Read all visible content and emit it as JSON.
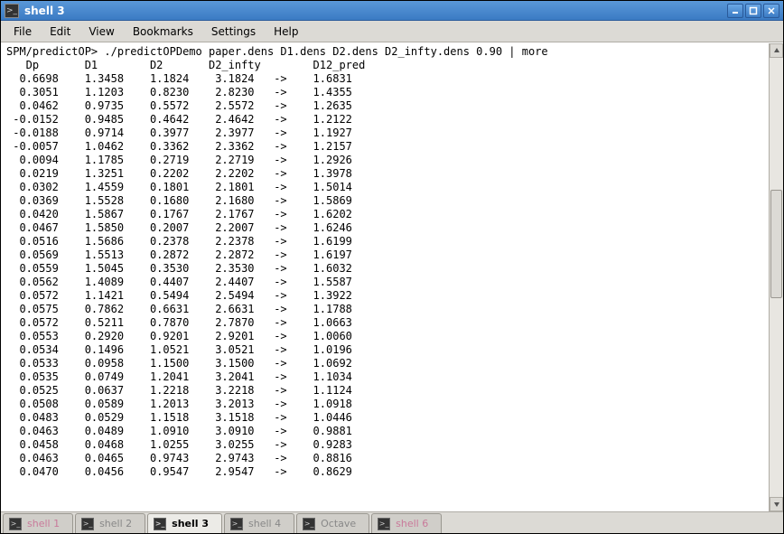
{
  "titlebar": {
    "title": "shell 3"
  },
  "menu": {
    "file": "File",
    "edit": "Edit",
    "view": "View",
    "bookmarks": "Bookmarks",
    "settings": "Settings",
    "help": "Help"
  },
  "prompt": "SPM/predictOP>",
  "command": "./predictOPDemo paper.dens D1.dens D2.dens D2_infty.dens 0.90 | more",
  "columns": [
    "Dp",
    "D1",
    "D2",
    "D2_infty",
    "D12_pred"
  ],
  "rows": [
    [
      "0.6698",
      "1.3458",
      "1.1824",
      "3.1824",
      "1.6831"
    ],
    [
      "0.3051",
      "1.1203",
      "0.8230",
      "2.8230",
      "1.4355"
    ],
    [
      "0.0462",
      "0.9735",
      "0.5572",
      "2.5572",
      "1.2635"
    ],
    [
      "-0.0152",
      "0.9485",
      "0.4642",
      "2.4642",
      "1.2122"
    ],
    [
      "-0.0188",
      "0.9714",
      "0.3977",
      "2.3977",
      "1.1927"
    ],
    [
      "-0.0057",
      "1.0462",
      "0.3362",
      "2.3362",
      "1.2157"
    ],
    [
      "0.0094",
      "1.1785",
      "0.2719",
      "2.2719",
      "1.2926"
    ],
    [
      "0.0219",
      "1.3251",
      "0.2202",
      "2.2202",
      "1.3978"
    ],
    [
      "0.0302",
      "1.4559",
      "0.1801",
      "2.1801",
      "1.5014"
    ],
    [
      "0.0369",
      "1.5528",
      "0.1680",
      "2.1680",
      "1.5869"
    ],
    [
      "0.0420",
      "1.5867",
      "0.1767",
      "2.1767",
      "1.6202"
    ],
    [
      "0.0467",
      "1.5850",
      "0.2007",
      "2.2007",
      "1.6246"
    ],
    [
      "0.0516",
      "1.5686",
      "0.2378",
      "2.2378",
      "1.6199"
    ],
    [
      "0.0569",
      "1.5513",
      "0.2872",
      "2.2872",
      "1.6197"
    ],
    [
      "0.0559",
      "1.5045",
      "0.3530",
      "2.3530",
      "1.6032"
    ],
    [
      "0.0562",
      "1.4089",
      "0.4407",
      "2.4407",
      "1.5587"
    ],
    [
      "0.0572",
      "1.1421",
      "0.5494",
      "2.5494",
      "1.3922"
    ],
    [
      "0.0575",
      "0.7862",
      "0.6631",
      "2.6631",
      "1.1788"
    ],
    [
      "0.0572",
      "0.5211",
      "0.7870",
      "2.7870",
      "1.0663"
    ],
    [
      "0.0553",
      "0.2920",
      "0.9201",
      "2.9201",
      "1.0060"
    ],
    [
      "0.0534",
      "0.1496",
      "1.0521",
      "3.0521",
      "1.0196"
    ],
    [
      "0.0533",
      "0.0958",
      "1.1500",
      "3.1500",
      "1.0692"
    ],
    [
      "0.0535",
      "0.0749",
      "1.2041",
      "3.2041",
      "1.1034"
    ],
    [
      "0.0525",
      "0.0637",
      "1.2218",
      "3.2218",
      "1.1124"
    ],
    [
      "0.0508",
      "0.0589",
      "1.2013",
      "3.2013",
      "1.0918"
    ],
    [
      "0.0483",
      "0.0529",
      "1.1518",
      "3.1518",
      "1.0446"
    ],
    [
      "0.0463",
      "0.0489",
      "1.0910",
      "3.0910",
      "0.9881"
    ],
    [
      "0.0458",
      "0.0468",
      "1.0255",
      "3.0255",
      "0.9283"
    ],
    [
      "0.0463",
      "0.0465",
      "0.9743",
      "2.9743",
      "0.8816"
    ],
    [
      "0.0470",
      "0.0456",
      "0.9547",
      "2.9547",
      "0.8629"
    ]
  ],
  "tabs": [
    {
      "label": "shell 1",
      "pink": true
    },
    {
      "label": "shell 2"
    },
    {
      "label": "shell 3",
      "active": true
    },
    {
      "label": "shell 4"
    },
    {
      "label": "Octave"
    },
    {
      "label": "shell 6",
      "pink": true
    }
  ]
}
